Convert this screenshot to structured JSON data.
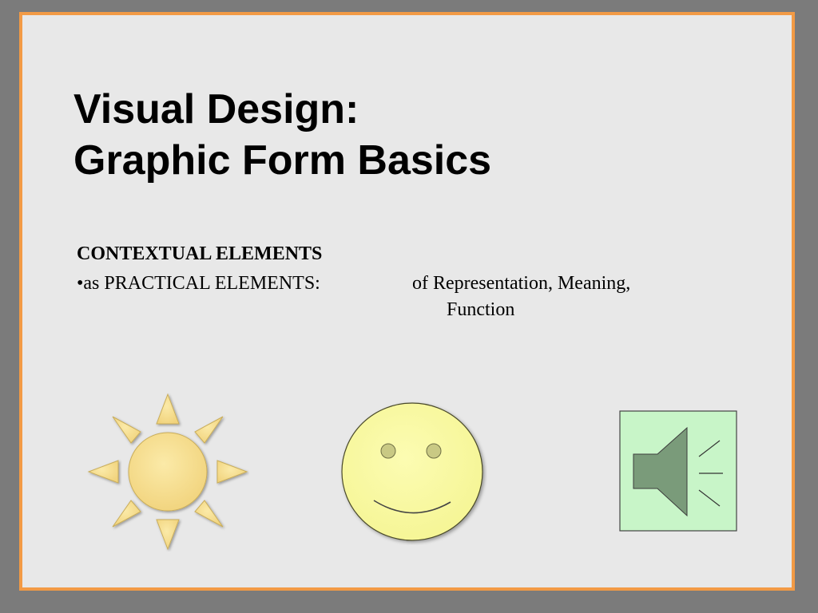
{
  "slide": {
    "title_line1": "Visual Design:",
    "title_line2": "Graphic Form Basics",
    "section_heading": "CONTEXTUAL ELEMENTS",
    "bullet": {
      "lead": "•as PRACTICAL ELEMENTS:",
      "description": "of Representation, Meaning,",
      "continuation": "Function"
    }
  },
  "illustrations": {
    "sun": {
      "icon": "sun-icon",
      "fill": "#f7e08e"
    },
    "smiley": {
      "icon": "smiley-face-icon",
      "fill": "#fafaa0"
    },
    "speaker": {
      "icon": "speaker-icon",
      "fill": "#c8f5c8",
      "cone": "#7a9b7a"
    }
  },
  "colors": {
    "background": "#7b7b7b",
    "slide": "#e8e8e8",
    "border": "#f29a45"
  }
}
